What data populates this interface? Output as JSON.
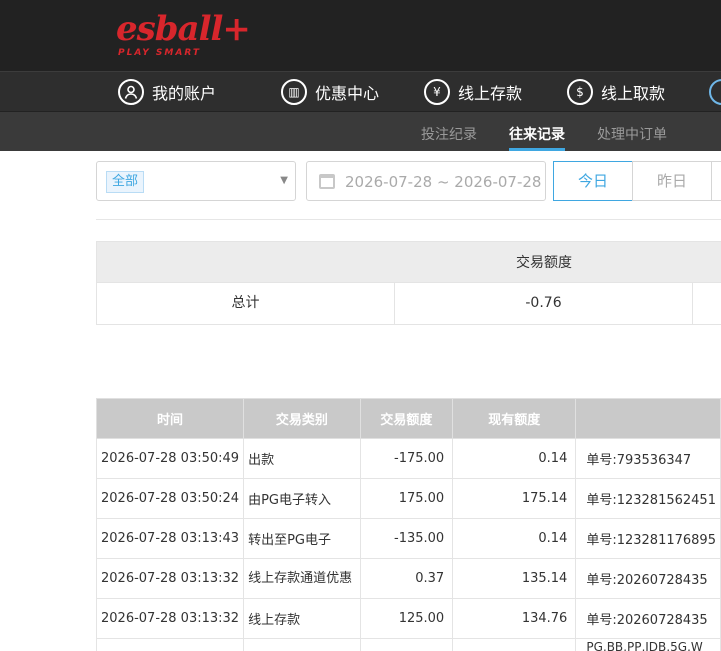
{
  "brand": {
    "logo_text": "esball+",
    "tagline": "PLAY SMART",
    "color": "#d8262c"
  },
  "nav": {
    "items": [
      {
        "label": "我的账户",
        "icon": "user-icon",
        "glyph": ""
      },
      {
        "label": "优惠中心",
        "icon": "gift-icon",
        "glyph": "▥"
      },
      {
        "label": "线上存款",
        "icon": "deposit-icon",
        "glyph": "¥"
      },
      {
        "label": "线上取款",
        "icon": "withdraw-icon",
        "glyph": "$"
      }
    ]
  },
  "subnav": {
    "items": [
      {
        "label": "投注纪录",
        "active": false
      },
      {
        "label": "往来记录",
        "active": true
      },
      {
        "label": "处理中订单",
        "active": false
      }
    ],
    "accent": "#3fa7e1"
  },
  "filters": {
    "type_tag": "全部",
    "date_range": "2026-07-28 ~ 2026-07-28",
    "today_label": "今日",
    "yesterday_label": "昨日"
  },
  "summary": {
    "header": "交易额度",
    "row_label": "总计",
    "row_value": "-0.76"
  },
  "transactions": {
    "columns": [
      "时间",
      "交易类别",
      "交易额度",
      "现有额度",
      ""
    ],
    "rows": [
      {
        "time": "2026-07-28 03:50:49",
        "type": "出款",
        "amount": "-175.00",
        "balance": "0.14",
        "note": "单号:793536347"
      },
      {
        "time": "2026-07-28 03:50:24",
        "type": "由PG电子转入",
        "amount": "175.00",
        "balance": "175.14",
        "note": "单号:123281562451"
      },
      {
        "time": "2026-07-28 03:13:43",
        "type": "转出至PG电子",
        "amount": "-135.00",
        "balance": "0.14",
        "note": "单号:123281176895"
      },
      {
        "time": "2026-07-28 03:13:32",
        "type": "线上存款通道优惠",
        "amount": "0.37",
        "balance": "135.14",
        "note": "单号:20260728435"
      },
      {
        "time": "2026-07-28 03:13:32",
        "type": "线上存款",
        "amount": "125.00",
        "balance": "134.76",
        "note": "单号:20260728435"
      },
      {
        "time": "",
        "type": "",
        "amount": "",
        "balance": "",
        "note": "PG,BB,PP,JDB,5G,W"
      }
    ]
  }
}
